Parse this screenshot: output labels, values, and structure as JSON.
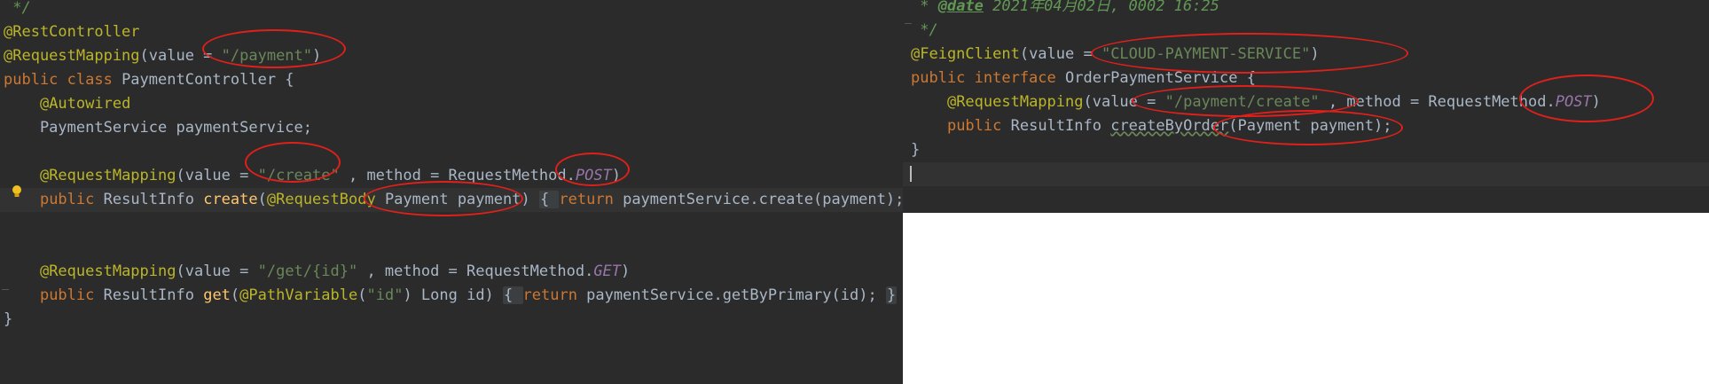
{
  "left_editor": {
    "lines": [
      {
        "tokens": [
          {
            "c": "cmt",
            "t": " */"
          }
        ]
      },
      {
        "tokens": [
          {
            "c": "ann",
            "t": "@RestController"
          }
        ]
      },
      {
        "tokens": [
          {
            "c": "ann",
            "t": "@RequestMapping"
          },
          {
            "c": "",
            "t": "(value = "
          },
          {
            "c": "str",
            "t": "\"/payment\""
          },
          {
            "c": "",
            "t": ")"
          }
        ]
      },
      {
        "tokens": [
          {
            "c": "kw",
            "t": "public class "
          },
          {
            "c": "",
            "t": "PaymentController {"
          }
        ]
      },
      {
        "tokens": [
          {
            "c": "",
            "t": "    "
          },
          {
            "c": "ann",
            "t": "@Autowired"
          }
        ]
      },
      {
        "tokens": [
          {
            "c": "",
            "t": "    PaymentService paymentService;"
          }
        ]
      },
      {
        "tokens": [
          {
            "c": "",
            "t": ""
          }
        ]
      },
      {
        "tokens": [
          {
            "c": "",
            "t": "    "
          },
          {
            "c": "ann",
            "t": "@RequestMapping"
          },
          {
            "c": "",
            "t": "(value = "
          },
          {
            "c": "str",
            "t": "\"/create\""
          },
          {
            "c": "",
            "t": " , method = RequestMethod."
          },
          {
            "c": "const",
            "t": "POST"
          },
          {
            "c": "",
            "t": ")"
          }
        ]
      },
      {
        "tokens": [
          {
            "c": "",
            "t": "    "
          },
          {
            "c": "kw",
            "t": "public "
          },
          {
            "c": "",
            "t": "ResultInfo "
          },
          {
            "c": "method",
            "t": "create"
          },
          {
            "c": "",
            "t": "("
          },
          {
            "c": "ann",
            "t": "@RequestBody "
          },
          {
            "c": "",
            "t": "Payment payment) "
          },
          {
            "c": "fold",
            "t": "{ "
          },
          {
            "c": "kw",
            "t": "return "
          },
          {
            "c": "",
            "t": "paymentService.create(payment); "
          },
          {
            "c": "fold",
            "t": "}"
          }
        ]
      },
      {
        "tokens": [
          {
            "c": "",
            "t": ""
          }
        ]
      },
      {
        "tokens": [
          {
            "c": "",
            "t": ""
          }
        ]
      },
      {
        "tokens": [
          {
            "c": "",
            "t": "    "
          },
          {
            "c": "ann",
            "t": "@RequestMapping"
          },
          {
            "c": "",
            "t": "(value = "
          },
          {
            "c": "str",
            "t": "\"/get/{id}\""
          },
          {
            "c": "",
            "t": " , method = RequestMethod."
          },
          {
            "c": "const",
            "t": "GET"
          },
          {
            "c": "",
            "t": ")"
          }
        ]
      },
      {
        "tokens": [
          {
            "c": "",
            "t": "    "
          },
          {
            "c": "kw",
            "t": "public "
          },
          {
            "c": "",
            "t": "ResultInfo "
          },
          {
            "c": "method",
            "t": "get"
          },
          {
            "c": "",
            "t": "("
          },
          {
            "c": "ann",
            "t": "@PathVariable"
          },
          {
            "c": "",
            "t": "("
          },
          {
            "c": "str",
            "t": "\"id\""
          },
          {
            "c": "",
            "t": ") Long id) "
          },
          {
            "c": "fold",
            "t": "{ "
          },
          {
            "c": "kw",
            "t": "return "
          },
          {
            "c": "",
            "t": "paymentService.getByPrimary(id); "
          },
          {
            "c": "fold",
            "t": "}"
          }
        ]
      },
      {
        "tokens": [
          {
            "c": "",
            "t": "}"
          }
        ]
      }
    ]
  },
  "right_editor": {
    "lines": [
      {
        "tokens": [
          {
            "c": "cmt",
            "t": " * "
          },
          {
            "c": "doctag",
            "t": "@date"
          },
          {
            "c": "cmt",
            "t": " 2021年04月02日, 0002 16:25"
          }
        ]
      },
      {
        "tokens": [
          {
            "c": "cmt",
            "t": " */"
          }
        ]
      },
      {
        "tokens": [
          {
            "c": "ann",
            "t": "@FeignClient"
          },
          {
            "c": "",
            "t": "(value = "
          },
          {
            "c": "str",
            "t": "\"CLOUD-PAYMENT-SERVICE\""
          },
          {
            "c": "",
            "t": ")"
          }
        ]
      },
      {
        "tokens": [
          {
            "c": "kw",
            "t": "public interface "
          },
          {
            "c": "",
            "t": "OrderPaymentService {"
          }
        ]
      },
      {
        "tokens": [
          {
            "c": "",
            "t": "    "
          },
          {
            "c": "ann",
            "t": "@RequestMapping"
          },
          {
            "c": "",
            "t": "(value = "
          },
          {
            "c": "str",
            "t": "\"/payment/create\""
          },
          {
            "c": "",
            "t": " , method = RequestMethod."
          },
          {
            "c": "const",
            "t": "POST"
          },
          {
            "c": "",
            "t": ")"
          }
        ]
      },
      {
        "tokens": [
          {
            "c": "",
            "t": "    "
          },
          {
            "c": "kw",
            "t": "public "
          },
          {
            "c": "",
            "t": "ResultInfo "
          },
          {
            "c": "squiggle",
            "t": "createByOrder"
          },
          {
            "c": "",
            "t": "(Payment payment);"
          }
        ]
      },
      {
        "tokens": [
          {
            "c": "",
            "t": "}"
          }
        ]
      },
      {
        "tokens": [
          {
            "c": "",
            "t": ""
          }
        ]
      }
    ]
  },
  "colors": {
    "editor_bg": "#2b2b2b",
    "annotation": "#bbb529",
    "keyword": "#cc7832",
    "string": "#6a8759",
    "constant": "#9876aa",
    "method": "#ffc66d",
    "highlight_ellipse": "#e0201a"
  },
  "icons": [
    "bulb-icon"
  ]
}
